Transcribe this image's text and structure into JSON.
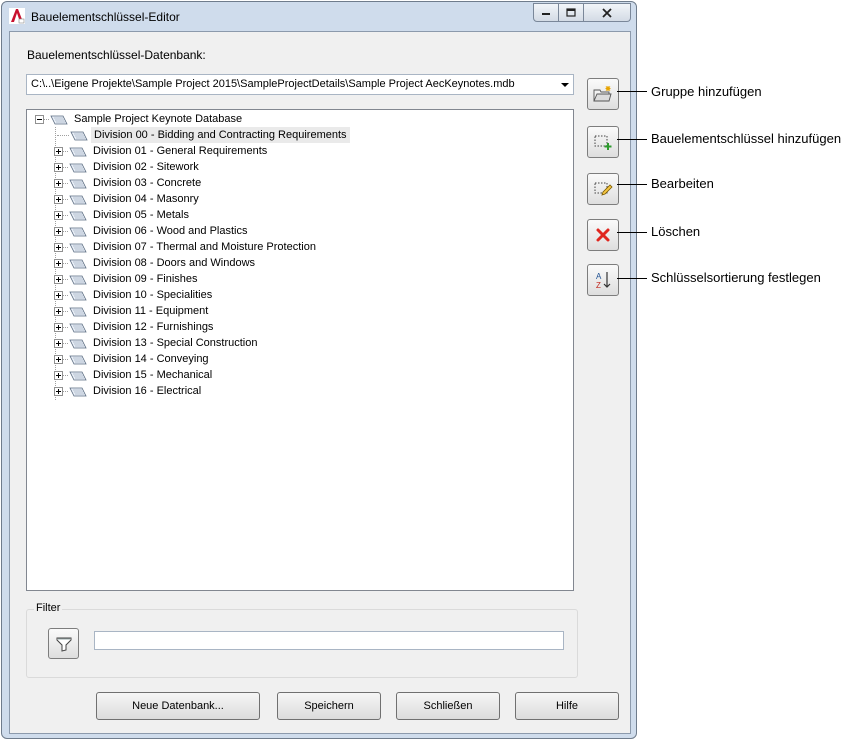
{
  "window": {
    "title": "Bauelementschlüssel-Editor"
  },
  "database": {
    "label": "Bauelementschlüssel-Datenbank:",
    "path": "C:\\..\\Eigene Projekte\\Sample Project 2015\\SampleProjectDetails\\Sample Project AecKeynotes.mdb"
  },
  "tree": {
    "root": "Sample Project Keynote Database",
    "items": [
      "Division 00 - Bidding and Contracting Requirements",
      "Division 01 - General Requirements",
      "Division 02 - Sitework",
      "Division 03 - Concrete",
      "Division 04 - Masonry",
      "Division 05 - Metals",
      "Division 06 - Wood and Plastics",
      "Division 07 - Thermal and Moisture Protection",
      "Division 08 - Doors and Windows",
      "Division 09 - Finishes",
      "Division 10 - Specialities",
      "Division 11 - Equipment",
      "Division 12 - Furnishings",
      "Division 13 - Special Construction",
      "Division 14 - Conveying",
      "Division 15 - Mechanical",
      "Division 16 - Electrical"
    ]
  },
  "filter": {
    "label": "Filter",
    "value": ""
  },
  "buttons": {
    "new_db": "Neue Datenbank...",
    "save": "Speichern",
    "close": "Schließen",
    "help": "Hilfe"
  },
  "callouts": {
    "add_group": "Gruppe hinzufügen",
    "add_keynote": "Bauelementschlüssel hinzufügen",
    "edit": "Bearbeiten",
    "delete": "Löschen",
    "sort": "Schlüsselsortierung festlegen"
  },
  "colors": {
    "frame": "#cfdcec",
    "client": "#f0f0f0",
    "delete_red": "#e0261f",
    "add_green": "#2e9b2e"
  }
}
